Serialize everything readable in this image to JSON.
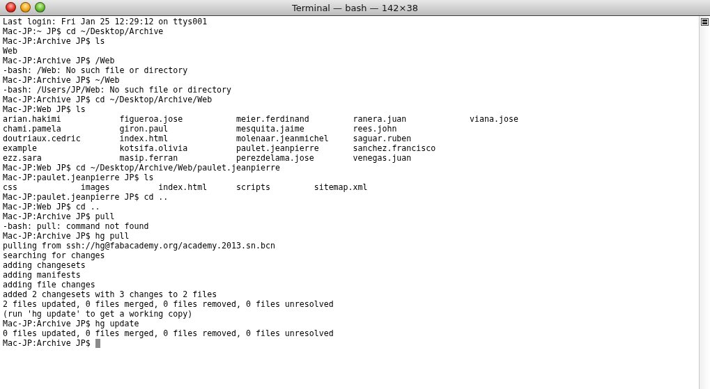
{
  "window": {
    "title": "Terminal — bash — 142×38"
  },
  "lines": [
    {
      "kind": "text",
      "text": "Last login: Fri Jan 25 12:29:12 on ttys001"
    },
    {
      "kind": "text",
      "text": "Mac-JP:~ JP$ cd ~/Desktop/Archive"
    },
    {
      "kind": "text",
      "text": "Mac-JP:Archive JP$ ls"
    },
    {
      "kind": "text",
      "text": "Web"
    },
    {
      "kind": "text",
      "text": "Mac-JP:Archive JP$ /Web"
    },
    {
      "kind": "text",
      "text": "-bash: /Web: No such file or directory"
    },
    {
      "kind": "text",
      "text": "Mac-JP:Archive JP$ ~/Web"
    },
    {
      "kind": "text",
      "text": "-bash: /Users/JP/Web: No such file or directory"
    },
    {
      "kind": "text",
      "text": "Mac-JP:Archive JP$ cd ~/Desktop/Archive/Web"
    },
    {
      "kind": "text",
      "text": "Mac-JP:Web JP$ ls"
    },
    {
      "kind": "listing",
      "rows": [
        [
          "arian.hakimi",
          "figueroa.jose",
          "meier.ferdinand",
          "ranera.juan",
          "viana.jose"
        ],
        [
          "chami.pamela",
          "giron.paul",
          "mesquita.jaime",
          "rees.john"
        ],
        [
          "doutriaux.cedric",
          "index.html",
          "molenaar.jeanmichel",
          "saguar.ruben"
        ],
        [
          "example",
          "kotsifa.olivia",
          "paulet.jeanpierre",
          "sanchez.francisco"
        ],
        [
          "ezz.sara",
          "masip.ferran",
          "perezdelama.jose",
          "venegas.juan"
        ]
      ]
    },
    {
      "kind": "text",
      "text": "Mac-JP:Web JP$ cd ~/Desktop/Archive/Web/paulet.jeanpierre"
    },
    {
      "kind": "text",
      "text": "Mac-JP:paulet.jeanpierre JP$ ls"
    },
    {
      "kind": "listing",
      "rows": [
        [
          "css",
          "images",
          "index.html",
          "scripts",
          "sitemap.xml"
        ]
      ]
    },
    {
      "kind": "text",
      "text": "Mac-JP:paulet.jeanpierre JP$ cd .."
    },
    {
      "kind": "text",
      "text": "Mac-JP:Web JP$ cd .."
    },
    {
      "kind": "text",
      "text": "Mac-JP:Archive JP$ pull"
    },
    {
      "kind": "text",
      "text": "-bash: pull: command not found"
    },
    {
      "kind": "text",
      "text": "Mac-JP:Archive JP$ hg pull"
    },
    {
      "kind": "text",
      "text": "pulling from ssh://hg@fabacademy.org/academy.2013.sn.bcn"
    },
    {
      "kind": "text",
      "text": "searching for changes"
    },
    {
      "kind": "text",
      "text": "adding changesets"
    },
    {
      "kind": "text",
      "text": "adding manifests"
    },
    {
      "kind": "text",
      "text": "adding file changes"
    },
    {
      "kind": "text",
      "text": "added 2 changesets with 3 changes to 2 files"
    },
    {
      "kind": "text",
      "text": "2 files updated, 0 files merged, 0 files removed, 0 files unresolved"
    },
    {
      "kind": "text",
      "text": "(run 'hg update' to get a working copy)"
    },
    {
      "kind": "text",
      "text": "Mac-JP:Archive JP$ hg update"
    },
    {
      "kind": "text",
      "text": "0 files updated, 0 files merged, 0 files removed, 0 files unresolved"
    },
    {
      "kind": "text",
      "text": "Mac-JP:Archive JP$ ",
      "cursor": true
    }
  ]
}
